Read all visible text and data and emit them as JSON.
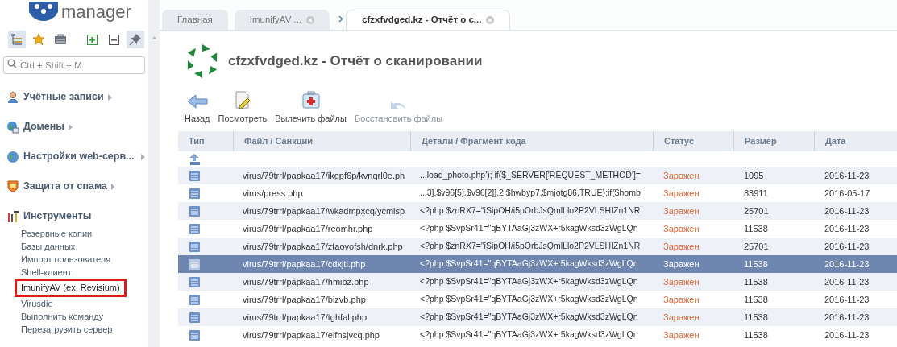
{
  "logo": {
    "text": "manager"
  },
  "sidebar": {
    "tools": [
      {
        "kind": "tree",
        "selected": true
      },
      {
        "kind": "star",
        "selected": false
      },
      {
        "kind": "briefcase",
        "selected": false
      },
      {
        "kind": "expand",
        "selected": false
      },
      {
        "kind": "collapse",
        "selected": false
      },
      {
        "kind": "pin",
        "selected": true
      }
    ],
    "search": {
      "placeholder": "Ctrl + Shift + M"
    },
    "groups": [
      {
        "kind": "users",
        "label": "Учётные записи",
        "expanded": false
      },
      {
        "kind": "globe",
        "label": "Домены",
        "expanded": false
      },
      {
        "kind": "web",
        "label": "Настройки web-серв...",
        "expanded": false
      },
      {
        "kind": "shield",
        "label": "Защита от спама",
        "expanded": false
      },
      {
        "kind": "tools",
        "label": "Инструменты",
        "expanded": true,
        "items": [
          {
            "label": "Резервные копии",
            "highlighted": false
          },
          {
            "label": "Базы данных",
            "highlighted": false
          },
          {
            "label": "Импорт пользователя",
            "highlighted": false
          },
          {
            "label": "Shell-клиент",
            "highlighted": false
          },
          {
            "label": "ImunifyAV (ex. Revisium)",
            "highlighted": true
          },
          {
            "label": "Virusdie",
            "highlighted": false
          },
          {
            "label": "Выполнить команду",
            "highlighted": false
          },
          {
            "label": "Перезагрузить сервер",
            "highlighted": false
          }
        ]
      }
    ]
  },
  "tabs": [
    {
      "label": "Главная",
      "selected": false,
      "closable": false
    },
    {
      "label": "ImunifyAV ...",
      "selected": false,
      "closable": true
    },
    {
      "label": "cfzxfvdged.kz - Отчёт о с...",
      "selected": true,
      "closable": true
    }
  ],
  "page_title": "cfzxfvdged.kz - Отчёт о сканировании",
  "toolbar": [
    {
      "kind": "back",
      "label": "Назад",
      "disabled": false
    },
    {
      "kind": "view",
      "label": "Посмотреть",
      "disabled": false
    },
    {
      "kind": "heal",
      "label": "Вылечить файлы",
      "disabled": false
    },
    {
      "kind": "restore",
      "label": "Восстановить файлы",
      "disabled": true
    }
  ],
  "table": {
    "columns": [
      "Тип",
      "Файл / Санкции",
      "Детали / Фрагмент кода",
      "Статус",
      "Размер",
      "Дата"
    ],
    "rows": [
      {
        "kind": "up",
        "selected": false
      },
      {
        "kind": "file",
        "selected": false,
        "file": "virus/79trrl/papkaa17/ikgpf6p/kvnqrl0e.ph",
        "details": "...load_photo.php'); if($_SERVER['REQUEST_METHOD']=",
        "status": "Заражен",
        "size": "1095",
        "date": "2016-11-23"
      },
      {
        "kind": "file",
        "selected": false,
        "file": "virus/press.php",
        "details": "...3].$v96[5].$v96[2]],2,$hwbyp7,$mjotg86,TRUE);if($homb",
        "status": "Заражен",
        "size": "83911",
        "date": "2016-05-17"
      },
      {
        "kind": "file",
        "selected": false,
        "file": "virus/79trrl/papkaa17/wkadmpxcq/ycmisp",
        "details": "<?php $znRX7=\"iSipOH/i5pOrbJsQmlLlo2P2VLSHIZn1NR",
        "status": "Заражен",
        "size": "25701",
        "date": "2016-11-23"
      },
      {
        "kind": "file",
        "selected": false,
        "file": "virus/79trrl/papkaa17/reomhr.php",
        "details": "<?php $SvpSr41=\"qBYTAaGj3zWX+r5kagWksd3zWgLQn",
        "status": "Заражен",
        "size": "11538",
        "date": "2016-11-23"
      },
      {
        "kind": "file",
        "selected": false,
        "file": "virus/79trrl/papkaa17/ztaovofsh/dnrk.php",
        "details": "<?php $znRX7=\"iSipOH/i5pOrbJsQmlLlo2P2VLSHIZn1NR",
        "status": "Заражен",
        "size": "25701",
        "date": "2016-11-23"
      },
      {
        "kind": "file",
        "selected": true,
        "file": "virus/79trrl/papkaa17/cdxjti.php",
        "details": "<?php $SvpSr41=\"qBYTAaGj3zWX+r5kagWksd3zWgLQn",
        "status": "Заражен",
        "size": "11538",
        "date": "2016-11-23"
      },
      {
        "kind": "file",
        "selected": false,
        "file": "virus/79trrl/papkaa17/hmibz.php",
        "details": "<?php $SvpSr41=\"qBYTAaGj3zWX+r5kagWksd3zWgLQn",
        "status": "Заражен",
        "size": "11538",
        "date": "2016-11-23"
      },
      {
        "kind": "file",
        "selected": false,
        "file": "virus/79trrl/papkaa17/bizvb.php",
        "details": "<?php $SvpSr41=\"qBYTAaGj3zWX+r5kagWksd3zWgLQn",
        "status": "Заражен",
        "size": "11538",
        "date": "2016-11-23"
      },
      {
        "kind": "file",
        "selected": false,
        "file": "virus/79trrl/papkaa17/tghfal.php",
        "details": "<?php $SvpSr41=\"qBYTAaGj3zWX+r5kagWksd3zWgLQn",
        "status": "Заражен",
        "size": "11538",
        "date": "2016-11-23"
      },
      {
        "kind": "file",
        "selected": false,
        "file": "virus/79trrl/papkaa17/elfnsjvcq.php",
        "details": "<?php $SvpSr41=\"qBYTAaGj3zWX+r5kagWksd3zWgLQn",
        "status": "Заражен",
        "size": "11538",
        "date": "2016-11-23"
      }
    ]
  }
}
